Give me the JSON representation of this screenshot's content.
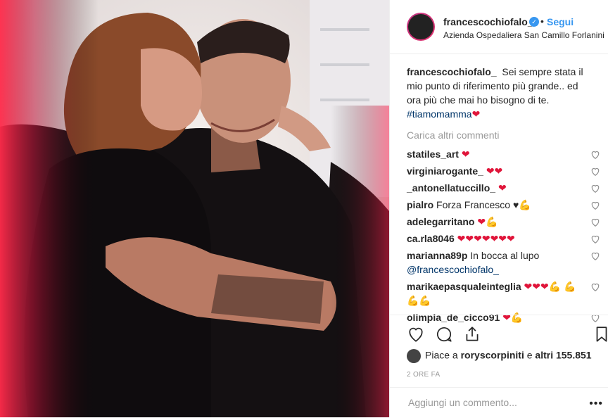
{
  "post": {
    "username": "francescochiofalo_",
    "follow_label": "Segui",
    "dot": "•",
    "location": "Azienda Ospedaliera San Camillo Forlanini"
  },
  "caption": {
    "username": "francescochiofalo_",
    "text": "Sei sempre stata il mio punto di riferimento più grande.. ed ora più che mai ho bisogno di te.",
    "hashtag": "#tiamomamma",
    "emoji": "❤"
  },
  "load_more": "Carica altri commenti",
  "comments": [
    {
      "user": "statiles_art",
      "text": " ❤"
    },
    {
      "user": "virginiarogante_",
      "text": " ❤❤"
    },
    {
      "user": "_antonellatuccillo_",
      "text": " ❤"
    },
    {
      "user": "pialro",
      "text": " Forza Francesco ♥💪"
    },
    {
      "user": "adelegarritano",
      "text": " ❤💪"
    },
    {
      "user": "ca.rla8046",
      "text": " ❤❤❤❤❤❤❤"
    },
    {
      "user": "marianna89p",
      "text": " In bocca al lupo",
      "mention": "@francescochiofalo_"
    },
    {
      "user": "marikaepasqualeinteglia",
      "text": " ❤❤❤💪 💪💪💪"
    },
    {
      "user": "olimpia_de_cicco91",
      "text": " ❤💪"
    }
  ],
  "likes": {
    "prefix": "Piace a ",
    "user": "roryscorpiniti",
    "middle": " e ",
    "others": "altri 155.851"
  },
  "time": "2 ORE FA",
  "add_comment": {
    "placeholder": "Aggiungi un commento...",
    "more": "•••"
  },
  "colors": {
    "link": "#3897f0",
    "heart": "#e0153a",
    "muted": "#999999"
  }
}
